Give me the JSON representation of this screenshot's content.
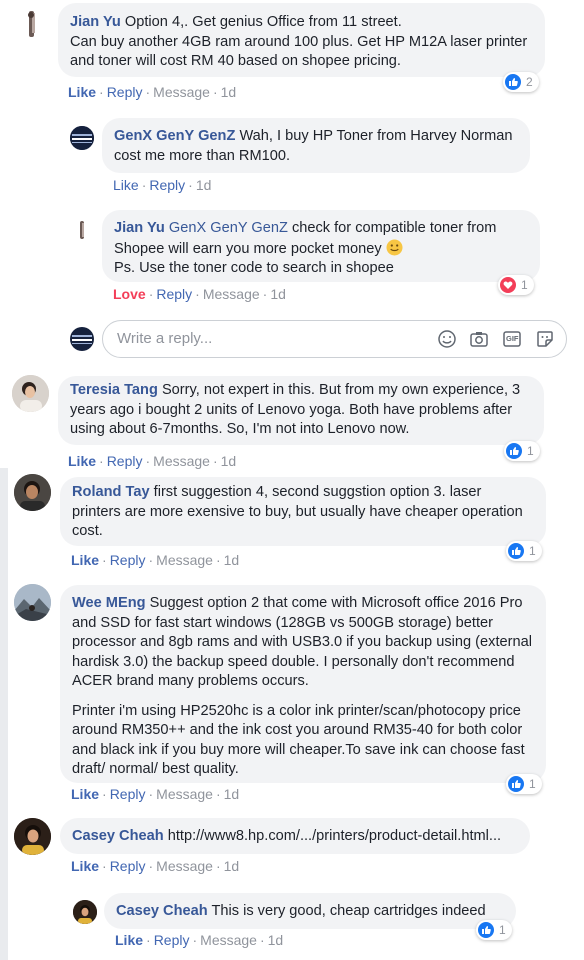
{
  "colors": {
    "link": "#385898",
    "action": "#4267b2",
    "love": "#f33e58",
    "like_badge": "#1877f2",
    "muted": "#90949c",
    "bubble": "#f2f3f5"
  },
  "comments": [
    {
      "author": "Jian Yu",
      "text": "Option 4,. Get genius Office from 11 street.\nCan buy another 4GB ram around 100 plus. Get HP M12A laser printer and toner will cost RM 40 based on shopee pricing.",
      "actions": {
        "react": "Like",
        "reply": "Reply",
        "message": "Message",
        "time": "1d"
      },
      "reaction": {
        "type": "like",
        "count": "2",
        "icon": "thumbs-up-icon"
      }
    },
    {
      "author": "GenX GenY GenZ",
      "text": "Wah, I buy HP Toner from Harvey Norman cost me more than RM100.",
      "actions": {
        "react": "Like",
        "reply": "Reply",
        "time": "1d"
      }
    },
    {
      "author": "Jian Yu",
      "mention": "GenX GenY GenZ",
      "text": "check for compatible toner from Shopee will earn you more pocket money",
      "text2": "Ps. Use the toner code to search in shopee",
      "actions": {
        "react": "Love",
        "reply": "Reply",
        "message": "Message",
        "time": "1d"
      },
      "reaction": {
        "type": "love",
        "count": "1",
        "icon": "heart-icon"
      }
    },
    {
      "author": "Teresia Tang",
      "text": "Sorry, not expert in this. But from my own experience, 3 years ago i bought 2 units of Lenovo yoga. Both have problems after using about 6-7months. So, I'm not into Lenovo now.",
      "actions": {
        "react": "Like",
        "reply": "Reply",
        "message": "Message",
        "time": "1d"
      },
      "reaction": {
        "type": "like",
        "count": "1",
        "icon": "thumbs-up-icon"
      }
    },
    {
      "author": "Roland Tay",
      "text": "first suggestion 4, second suggstion option 3. laser printers are more exensive to buy, but usually have cheaper operation cost.",
      "actions": {
        "react": "Like",
        "reply": "Reply",
        "message": "Message",
        "time": "1d"
      },
      "reaction": {
        "type": "like",
        "count": "1",
        "icon": "thumbs-up-icon"
      }
    },
    {
      "author": "Wee MEng",
      "text": "Suggest option 2 that come with Microsoft office 2016 Pro and SSD for fast start windows (128GB vs 500GB storage) better processor and 8gb rams and with USB3.0 if you backup using (external hardisk 3.0) the backup speed double. I personally don't recommend ACER brand many problems occurs.",
      "text2": "Printer i'm using HP2520hc is a color ink printer/scan/photocopy price around RM350++ and the ink cost you around RM35-40 for both color and black ink if you buy more will cheaper.To save ink can choose fast draft/ normal/ best quality.",
      "actions": {
        "react": "Like",
        "reply": "Reply",
        "message": "Message",
        "time": "1d"
      },
      "reaction": {
        "type": "like",
        "count": "1",
        "icon": "thumbs-up-icon"
      }
    },
    {
      "author": "Casey Cheah",
      "text": "http://www8.hp.com/.../printers/product-detail.html...",
      "actions": {
        "react": "Like",
        "reply": "Reply",
        "message": "Message",
        "time": "1d"
      }
    },
    {
      "author": "Casey Cheah",
      "text": "This is very good, cheap cartridges indeed",
      "actions": {
        "react": "Like",
        "reply": "Reply",
        "message": "Message",
        "time": "1d"
      },
      "reaction": {
        "type": "like",
        "count": "1",
        "icon": "thumbs-up-icon"
      }
    }
  ],
  "reply_box": {
    "placeholder": "Write a reply...",
    "tools": [
      "emoji-icon",
      "camera-icon",
      "gif-icon",
      "sticker-icon"
    ],
    "gif_label": "GIF"
  }
}
